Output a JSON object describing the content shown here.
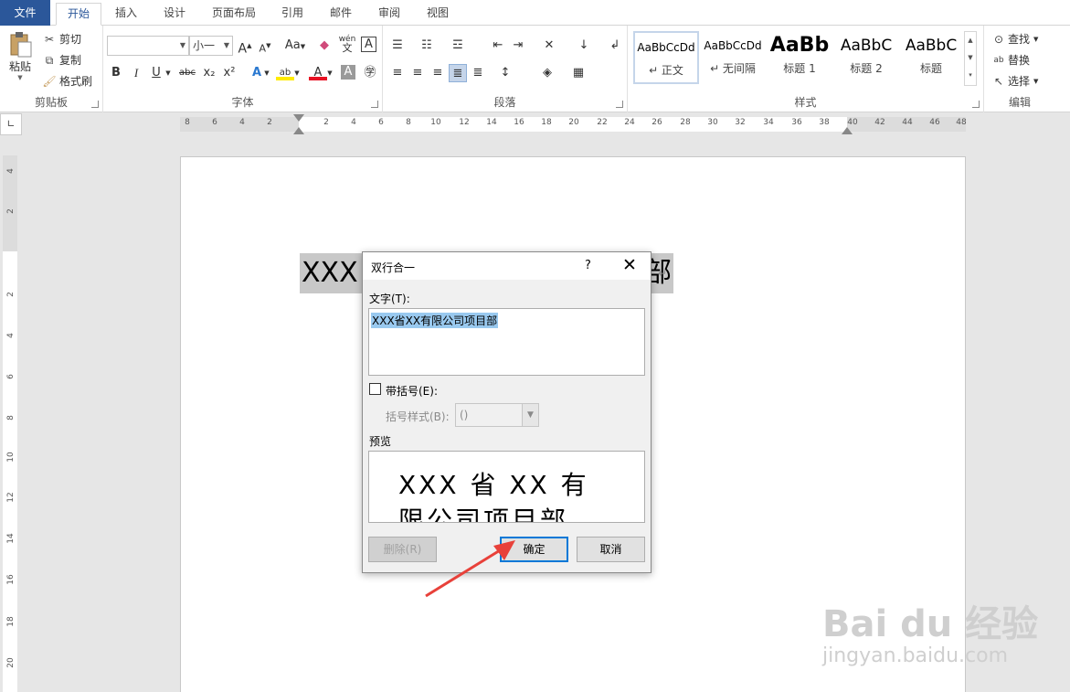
{
  "tabs": {
    "file": "文件",
    "home": "开始",
    "insert": "插入",
    "design": "设计",
    "layout": "页面布局",
    "references": "引用",
    "mailings": "邮件",
    "review": "审阅",
    "view": "视图"
  },
  "clipboard": {
    "paste": "粘贴",
    "cut": "剪切",
    "copy": "复制",
    "format_painter": "格式刷",
    "label": "剪贴板"
  },
  "font": {
    "name_value": "",
    "size_value": "小一",
    "grow": "A",
    "shrink": "A",
    "case": "Aa",
    "phonetic": "wén",
    "bold": "B",
    "italic": "I",
    "underline": "U",
    "strike": "abc",
    "subscript": "x₂",
    "superscript": "x²",
    "label": "字体"
  },
  "paragraph": {
    "label": "段落"
  },
  "styles": {
    "items": [
      {
        "sample": "AaBbCcDd",
        "name": "↵ 正文"
      },
      {
        "sample": "AaBbCcDd",
        "name": "↵ 无间隔"
      },
      {
        "sample": "AaBb",
        "name": "标题 1"
      },
      {
        "sample": "AaBbC",
        "name": "标题 2"
      },
      {
        "sample": "AaBbC",
        "name": "标题"
      }
    ],
    "label": "样式"
  },
  "editing": {
    "find": "查找",
    "replace": "替换",
    "select": "选择",
    "label": "编辑"
  },
  "ruler": {
    "h": [
      "8",
      "6",
      "4",
      "2",
      "2",
      "4",
      "6",
      "8",
      "10",
      "12",
      "14",
      "16",
      "18",
      "20",
      "22",
      "24",
      "26",
      "28",
      "30",
      "32",
      "34",
      "36",
      "38",
      "40",
      "42",
      "44",
      "46",
      "48"
    ],
    "v": [
      "4",
      "2",
      "2",
      "4",
      "6",
      "8",
      "10",
      "12",
      "14",
      "16",
      "18",
      "20"
    ]
  },
  "document": {
    "text_left": "XXX 省",
    "text_right": "部"
  },
  "dialog": {
    "title": "双行合一",
    "help": "?",
    "close": "✕",
    "text_label": "文字(T):",
    "text_value": "XXX省XX有限公司项目部",
    "bracket_checkbox": "带括号(E):",
    "bracket_style_label": "括号样式(B):",
    "bracket_style_value": "()",
    "preview_label": "预览",
    "preview_line1": "XXX 省 XX 有",
    "preview_line2": "限公司项目部",
    "delete_button": "删除(R)",
    "ok_button": "确定",
    "cancel_button": "取消"
  },
  "watermark": {
    "brand": "Bai du 经验",
    "url": "jingyan.baidu.com"
  }
}
